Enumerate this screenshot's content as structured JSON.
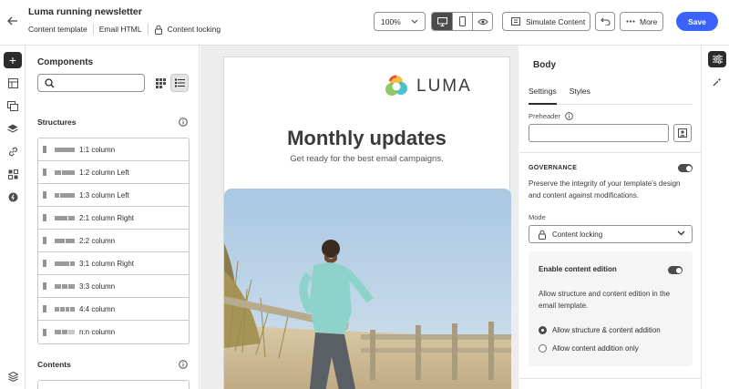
{
  "header": {
    "title": "Luma running newsletter",
    "nav": [
      "Content template",
      "Email HTML"
    ],
    "lock_label": "Content locking",
    "zoom": "100%",
    "simulate_label": "Simulate Content",
    "more_label": "More",
    "save_label": "Save"
  },
  "components": {
    "title": "Components",
    "search_placeholder": "",
    "structures_title": "Structures",
    "contents_title": "Contents",
    "structures": [
      {
        "label": "1:1 column",
        "cols": 1
      },
      {
        "label": "1:2 column Left",
        "cols": 2
      },
      {
        "label": "1:3 column Left",
        "cols": 2
      },
      {
        "label": "2:1 column Right",
        "cols": 2
      },
      {
        "label": "2:2 column",
        "cols": 2
      },
      {
        "label": "3:1 column Right",
        "cols": 2
      },
      {
        "label": "3:3 column",
        "cols": 3
      },
      {
        "label": "4:4 column",
        "cols": 4
      },
      {
        "label": "n:n column",
        "cols": 3
      }
    ]
  },
  "email": {
    "logo_text": "LUMA",
    "title": "Monthly updates",
    "subtitle": "Get ready for the best email campaigns."
  },
  "properties": {
    "title": "Body",
    "tabs": [
      "Settings",
      "Styles"
    ],
    "preheader_label": "Preheader",
    "governance_label": "GOVERNANCE",
    "governance_desc": "Preserve the integrity of your template's design and content against modifications.",
    "mode_label": "Mode",
    "mode_value": "Content locking",
    "edition_title": "Enable content edition",
    "edition_desc": "Allow structure and content edition in the email template.",
    "radio_options": [
      "Allow structure & content addition",
      "Allow content addition only"
    ],
    "radio_selected": 0
  },
  "colors": {
    "accent": "#3b63fb",
    "dark": "#2c2c2c"
  }
}
